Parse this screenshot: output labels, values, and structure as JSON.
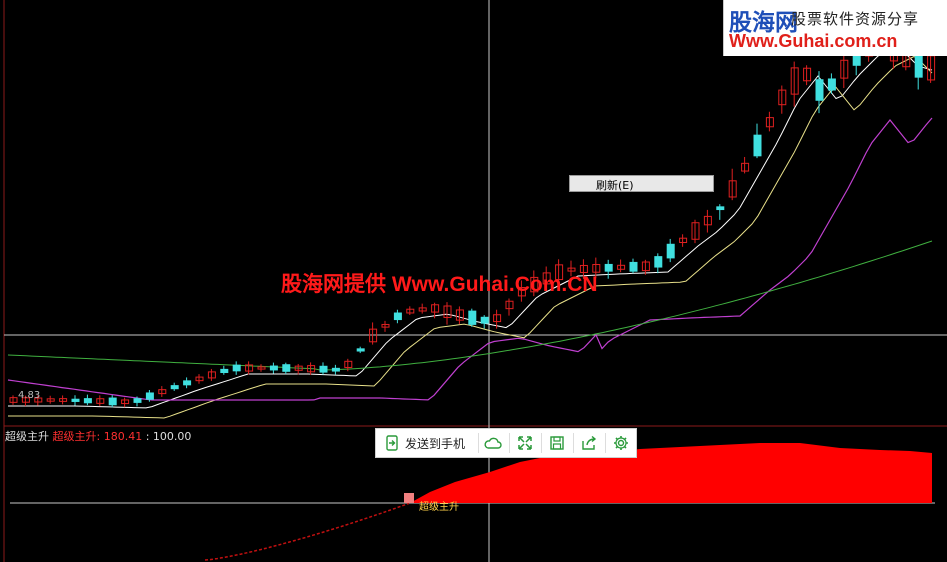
{
  "colors": {
    "up_candle": "#e02020",
    "down_candle": "#40e0e0",
    "ma_fast": "#ffffff",
    "ma_mid": "#e8e08a",
    "ma_slow": "#c040d0",
    "ma_long": "#40b040",
    "indicator_fill": "#ff0000",
    "indicator_line": "#c01010",
    "crosshair": "#c8c8c8",
    "grid_red": "#8b1a1a"
  },
  "logo": {
    "brand": "股海网",
    "tagline": "股票软件资源分享",
    "url": "Www.Guhai.com.cn"
  },
  "watermark": "股海网提供 Www.Guhai.Com.CN",
  "context_menu": {
    "refresh_label": "刷新(E)"
  },
  "toolbar": {
    "send_to_phone_label": "发送到手机",
    "icons": [
      "cloud-icon",
      "expand-icon",
      "save-icon",
      "share-icon",
      "settings-icon"
    ]
  },
  "indicator": {
    "name": "超级主升",
    "series_name": "超级主升:",
    "value": "180.41",
    "level": ": 100.00",
    "marker_label": "超级主升"
  },
  "price_axis": {
    "low_label": "4.83"
  }
}
